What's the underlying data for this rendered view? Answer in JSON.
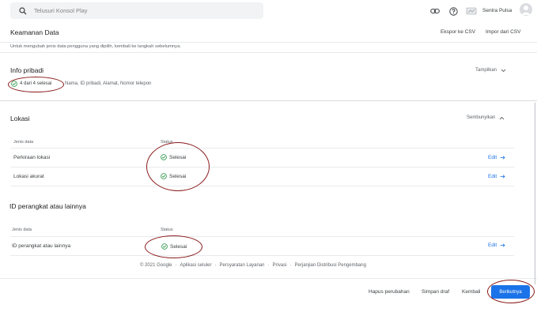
{
  "header": {
    "search_placeholder": "Telusuri Konsol Play",
    "account_name": "Sentra Pulsa",
    "icons": [
      "search-icon",
      "link-icon",
      "help-icon",
      "developer-icon",
      "avatar"
    ]
  },
  "page": {
    "title": "Keamanan Data",
    "export_label": "Ekspor ke CSV",
    "import_label": "Impor dari CSV",
    "hint": "Untuk mengubah jenis data pengguna yang dipilih, kembali ke langkah sebelumnya."
  },
  "personal_info": {
    "title": "Info pribadi",
    "toggle_label": "Tampilkan",
    "progress_text": "4 dari 4 selesai",
    "types_text": "Nama, ID pribadi, Alamat, Nomor telepon"
  },
  "location": {
    "title": "Lokasi",
    "toggle_label": "Sembunyikan",
    "col_type": "Jenis data",
    "col_status": "Status",
    "rows": [
      {
        "name": "Perkiraan lokasi",
        "status": "Selesai",
        "action": "Edit"
      },
      {
        "name": "Lokasi akurat",
        "status": "Selesai",
        "action": "Edit"
      }
    ]
  },
  "device": {
    "title": "ID perangkat atau lainnya",
    "col_type": "Jenis data",
    "col_status": "Status",
    "rows": [
      {
        "name": "ID perangkat atau lainnya",
        "status": "Selesai",
        "action": "Edit"
      }
    ]
  },
  "footer": {
    "copyright": "© 2021 Google",
    "links": [
      "Aplikasi seluler",
      "Persyaratan Layanan",
      "Privasi",
      "Perjanjian Distribusi Pengembang"
    ]
  },
  "actions": {
    "discard": "Hapus perubahan",
    "save_draft": "Simpan draf",
    "back": "Kembali",
    "next": "Berikutnya"
  },
  "colors": {
    "accent": "#1a73e8",
    "success": "#1e8e3e",
    "annotation": "#8b1a1a"
  }
}
